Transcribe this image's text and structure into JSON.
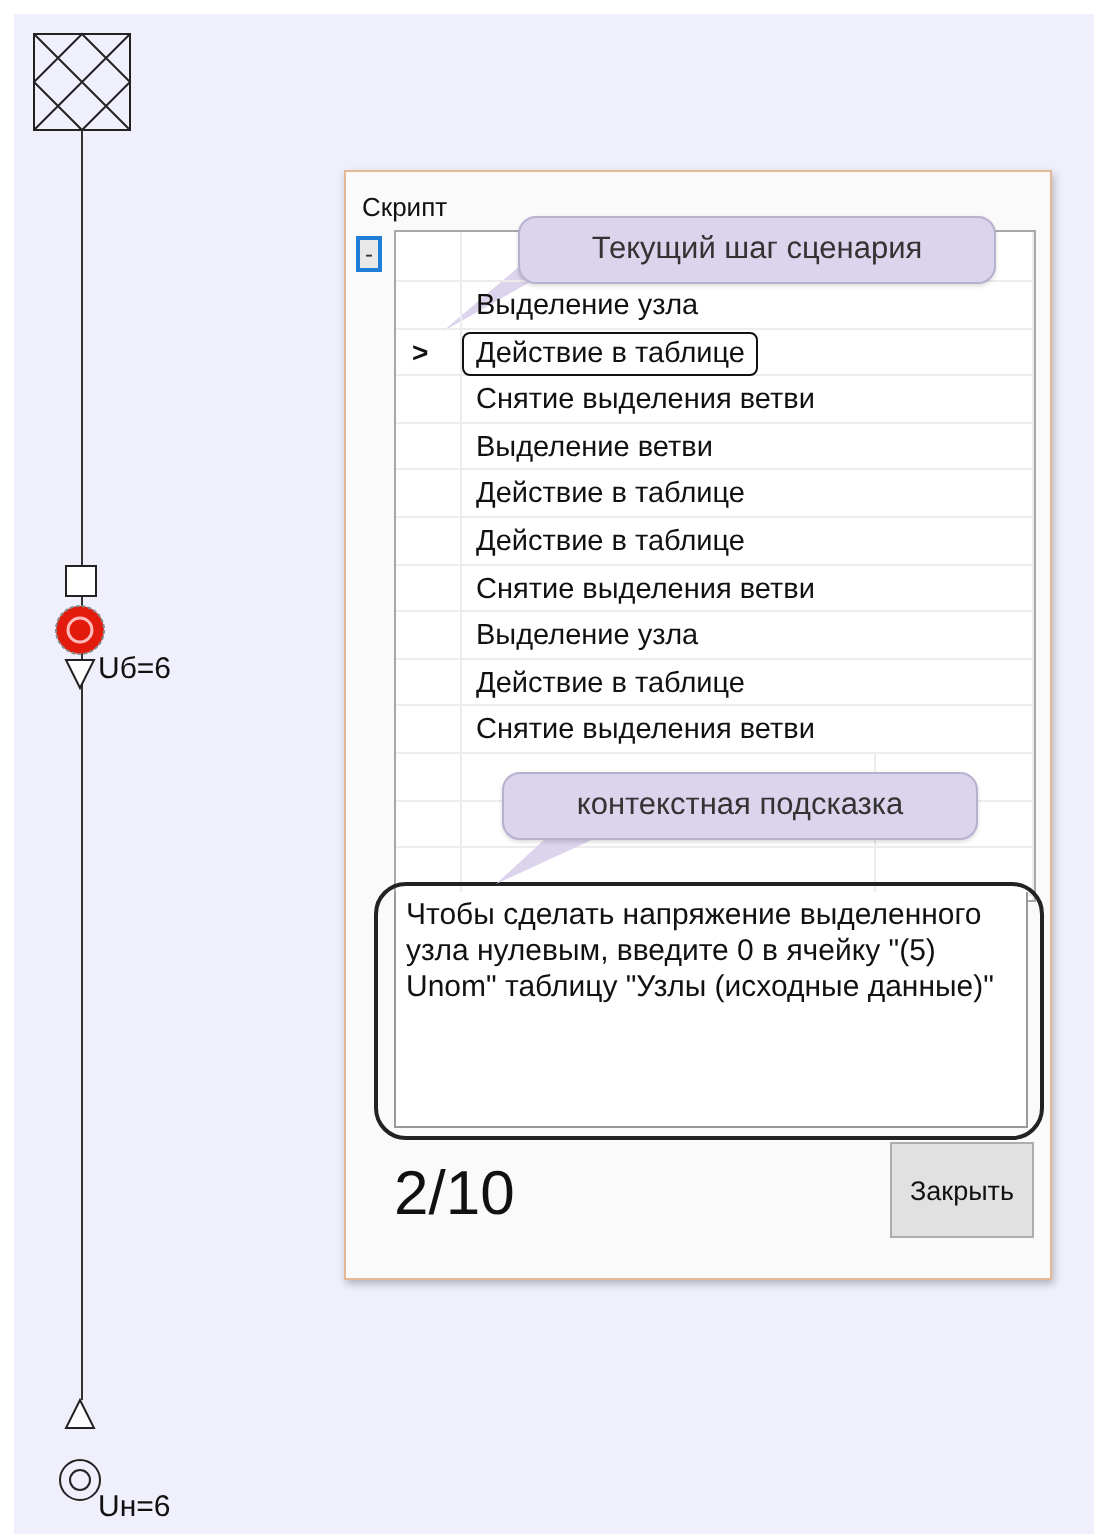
{
  "diagram": {
    "labels": [
      "Uб=6",
      "Uн=6"
    ]
  },
  "dialog": {
    "title": "Скрипт",
    "collapse_button": "-",
    "current_marker": ">",
    "steps": [
      {
        "label": "Выделение узла",
        "selected": false
      },
      {
        "label": "Действие в таблице",
        "selected": true
      },
      {
        "label": "Снятие выделения ветви",
        "selected": false
      },
      {
        "label": "Выделение ветви",
        "selected": false
      },
      {
        "label": "Действие в таблице",
        "selected": false
      },
      {
        "label": "Действие в таблице",
        "selected": false
      },
      {
        "label": "Снятие выделения ветви",
        "selected": false
      },
      {
        "label": "Выделение узла",
        "selected": false
      },
      {
        "label": "Действие в таблице",
        "selected": false
      },
      {
        "label": "Снятие выделения ветви",
        "selected": false
      }
    ],
    "hint": "Чтобы сделать напряжение выделенного узла нулевым, введите 0 в ячейку \"(5) Unom\" таблицу \"Узлы (исходные данные)\"",
    "counter": "2/10",
    "close_button": "Закрыть"
  },
  "callouts": [
    "Текущий шаг сценария",
    "контекстная подсказка"
  ]
}
